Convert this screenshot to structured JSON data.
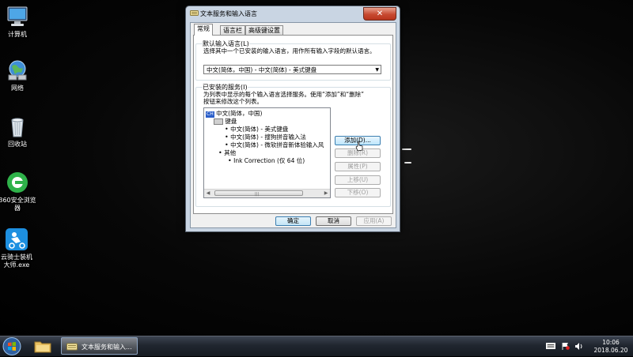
{
  "desktop": {
    "icons": [
      {
        "label": "计算机",
        "icon": "computer-icon"
      },
      {
        "label": "网络",
        "icon": "network-icon"
      },
      {
        "label": "回收站",
        "icon": "recycle-bin-icon"
      },
      {
        "label": "360安全浏览器",
        "icon": "360-browser-icon"
      },
      {
        "label": "云骑士装机大师.exe",
        "icon": "yunqishi-icon"
      }
    ]
  },
  "dialog": {
    "title": "文本服务和输入语言",
    "close_label": "✕",
    "tabs": [
      "常规",
      "语言栏",
      "高级键设置"
    ],
    "default_lang": {
      "group_title": "默认输入语言(L)",
      "description": "选择其中一个已安装的输入语言，用作所有输入字段的默认语言。",
      "selected": "中文(简体，中国) - 中文(简体) - 美式键盘"
    },
    "installed": {
      "group_title": "已安装的服务(I)",
      "description_line1": "为列表中显示的每个输入语言选择服务。使用“添加”和“删除”",
      "description_line2": "按钮来修改这个列表。",
      "tree": {
        "lang_badge": "CH",
        "root": "中文(简体，中国)",
        "keyboard_label": "键盘",
        "keyboard_items": [
          "中文(简体) - 美式键盘",
          "中文(简体) - 搜狗拼音输入法",
          "中文(简体) - 微软拼音新体验输入风"
        ],
        "other_label": "其他",
        "other_items": [
          "Ink Correction (仅 64 位)"
        ]
      },
      "buttons": {
        "add": "添加(D)...",
        "remove": "删除(R)",
        "properties": "属性(P)",
        "move_up": "上移(U)",
        "move_down": "下移(O)"
      }
    },
    "footer": {
      "ok": "确定",
      "cancel": "取消",
      "apply": "应用(A)"
    }
  },
  "taskbar": {
    "window_label": "文本服务和输入...",
    "clock_time": "10:06",
    "clock_date": "2018.06.20"
  }
}
